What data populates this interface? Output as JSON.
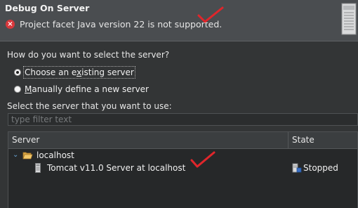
{
  "dialog": {
    "title": "Debug On Server",
    "error_message": "Project facet Java version 22 is not supported."
  },
  "selection": {
    "prompt": "How do you want to select the server?",
    "options": [
      {
        "label_pre": "Choose an e",
        "mnemonic": "x",
        "label_post": "isting server",
        "checked": true
      },
      {
        "label_pre": "",
        "mnemonic": "M",
        "label_post": "anually define a new server",
        "checked": false
      }
    ]
  },
  "server_list": {
    "label": "Select the server that you want to use:",
    "filter_placeholder": "type filter text",
    "columns": [
      "Server",
      "State"
    ],
    "tree": {
      "group": "localhost",
      "expanded": true,
      "servers": [
        {
          "name": "Tomcat v11.0 Server at localhost",
          "state": "Stopped"
        }
      ]
    }
  },
  "annotation_color": "#e0262b",
  "colors": {
    "background": "#333536",
    "header": "#4a4d50",
    "error": "#d8383c",
    "tree_chevron": "#6aa7d8"
  }
}
